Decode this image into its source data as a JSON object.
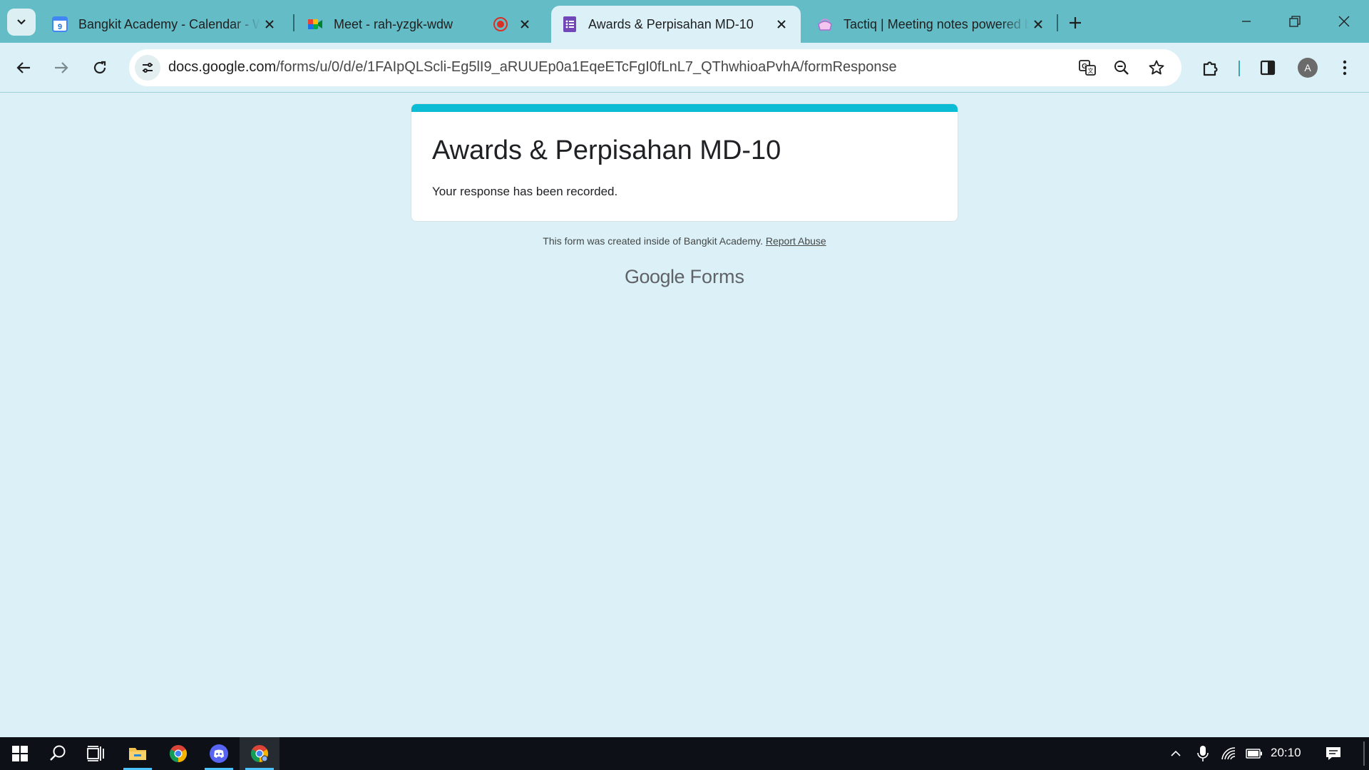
{
  "browser": {
    "tabs": [
      {
        "title": "Bangkit Academy - Calendar - Week",
        "favicon": "calendar-icon"
      },
      {
        "title": "Meet - rah-yzgk-wdw",
        "favicon": "meet-icon",
        "recording": true
      },
      {
        "title": "Awards & Perpisahan MD-10",
        "favicon": "forms-icon",
        "active": true
      },
      {
        "title": "Tactiq | Meeting notes powered by AI",
        "favicon": "tactiq-icon"
      }
    ],
    "url_host": "docs.google.com",
    "url_path": "/forms/u/0/d/e/1FAIpQLScli-Eg5lI9_aRUUEp0a1EqeETcFgI0fLnL7_QThwhioaPvhA/formResponse",
    "profile_initial": "A"
  },
  "form": {
    "title": "Awards & Perpisahan MD-10",
    "message": "Your response has been recorded.",
    "footer_text": "This form was created inside of Bangkit Academy.",
    "report_link": "Report Abuse",
    "brand_google": "Google",
    "brand_forms": "Forms"
  },
  "taskbar": {
    "clock": "20:10"
  },
  "colors": {
    "tabstrip": "#64bcc7",
    "page_bg": "#dbf1f7",
    "form_accent": "#0cbcd4",
    "taskbar": "#0d1117"
  }
}
